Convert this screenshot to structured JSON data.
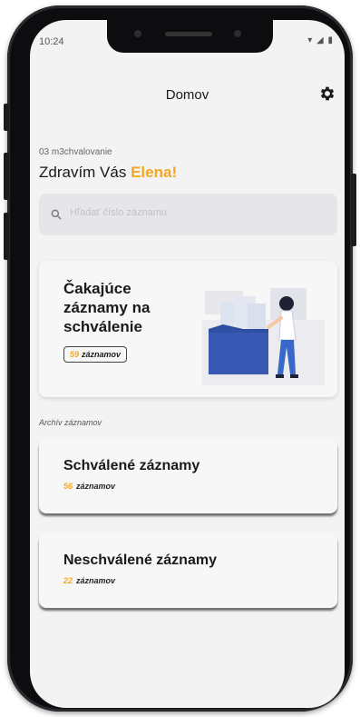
{
  "status": {
    "time": "10:24",
    "icons": "▾ ◢ ▮"
  },
  "header": {
    "title": "Domov",
    "settings_icon": "gear-icon"
  },
  "greeting": {
    "subtitle": "03 m3chvalovanie",
    "hello": "Zdravím Vás",
    "name": "Elena!"
  },
  "search": {
    "placeholder": "Hľadať číslo záznamu"
  },
  "pending": {
    "title": "Čakajúce záznamy na schválenie",
    "count": "59",
    "unit": "záznamov"
  },
  "archive": {
    "label": "Archív záznamov",
    "cards": [
      {
        "title": "Schválené záznamy",
        "count": "56",
        "unit": "záznamov"
      },
      {
        "title": "Neschválené záznamy",
        "count": "22",
        "unit": "záznamov"
      }
    ]
  },
  "colors": {
    "accent": "#f5a623",
    "folder": "#2f4fa3"
  }
}
